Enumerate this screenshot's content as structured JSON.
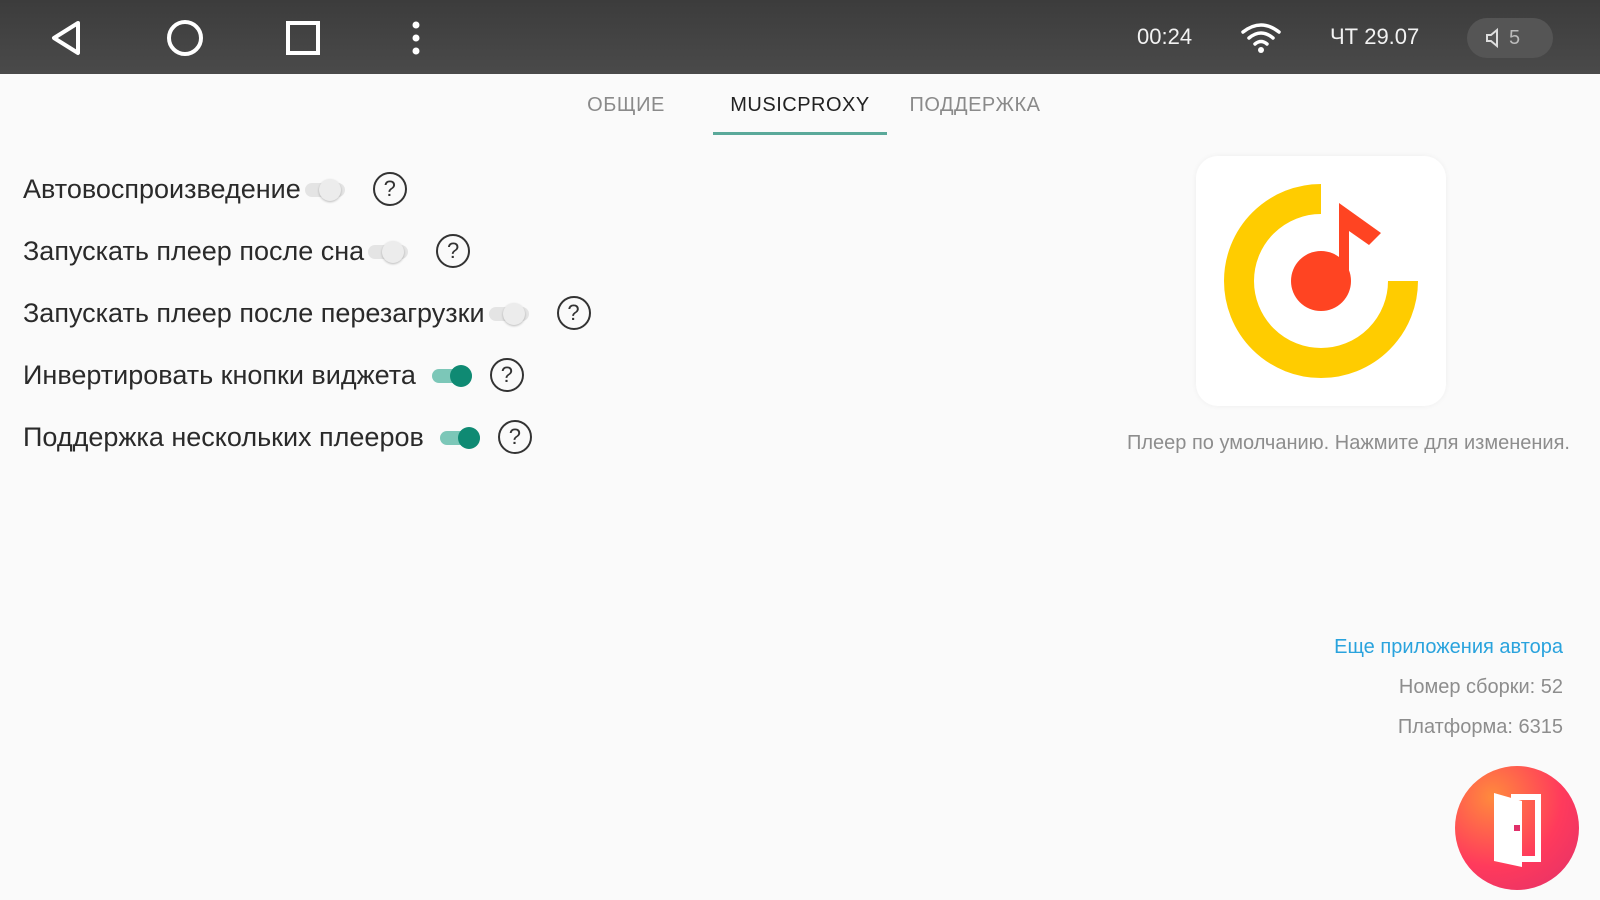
{
  "statusbar": {
    "time": "00:24",
    "date": "ЧТ 29.07",
    "volume": "5",
    "icons": {
      "back": "back-triangle-icon",
      "home": "home-circle-icon",
      "recents": "recents-square-icon",
      "menu": "more-vert-icon",
      "wifi": "wifi-icon",
      "volume": "speaker-icon"
    }
  },
  "tabs": [
    {
      "label": "ОБЩИЕ",
      "active": false
    },
    {
      "label": "MUSICPROXY",
      "active": true
    },
    {
      "label": "ПОДДЕРЖКА",
      "active": false
    }
  ],
  "settings": [
    {
      "label": "Автовоспроизведение",
      "on": false
    },
    {
      "label": "Запускать плеер после сна",
      "on": false
    },
    {
      "label": "Запускать плеер после перезагрузки",
      "on": false
    },
    {
      "label": "Инвертировать кнопки виджета",
      "on": true
    },
    {
      "label": "Поддержка нескольких плееров",
      "on": true
    }
  ],
  "help_symbol": "?",
  "player": {
    "icon": "yandex-music-icon",
    "caption": "Плеер по умолчанию. Нажмите для изменения."
  },
  "info": {
    "more_apps_link": "Еще приложения автора",
    "build": "Номер сборки: 52",
    "platform": "Платформа: 6315"
  },
  "exit_icon": "exit-door-icon",
  "colors": {
    "accent": "#0f8a73",
    "link": "#29a3dd",
    "player_yellow": "#ffcc00",
    "player_red": "#ff4422"
  }
}
